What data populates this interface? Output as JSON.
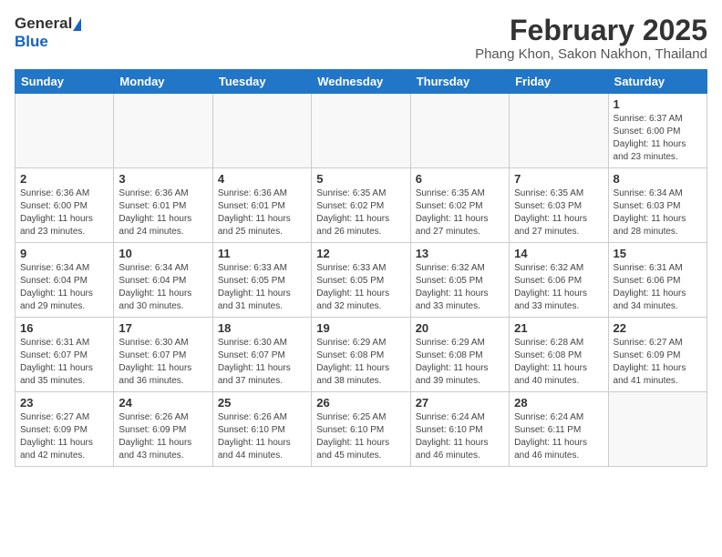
{
  "header": {
    "logo_general": "General",
    "logo_blue": "Blue",
    "title": "February 2025",
    "subtitle": "Phang Khon, Sakon Nakhon, Thailand"
  },
  "columns": [
    "Sunday",
    "Monday",
    "Tuesday",
    "Wednesday",
    "Thursday",
    "Friday",
    "Saturday"
  ],
  "weeks": [
    [
      {
        "day": "",
        "info": ""
      },
      {
        "day": "",
        "info": ""
      },
      {
        "day": "",
        "info": ""
      },
      {
        "day": "",
        "info": ""
      },
      {
        "day": "",
        "info": ""
      },
      {
        "day": "",
        "info": ""
      },
      {
        "day": "1",
        "info": "Sunrise: 6:37 AM\nSunset: 6:00 PM\nDaylight: 11 hours\nand 23 minutes."
      }
    ],
    [
      {
        "day": "2",
        "info": "Sunrise: 6:36 AM\nSunset: 6:00 PM\nDaylight: 11 hours\nand 23 minutes."
      },
      {
        "day": "3",
        "info": "Sunrise: 6:36 AM\nSunset: 6:01 PM\nDaylight: 11 hours\nand 24 minutes."
      },
      {
        "day": "4",
        "info": "Sunrise: 6:36 AM\nSunset: 6:01 PM\nDaylight: 11 hours\nand 25 minutes."
      },
      {
        "day": "5",
        "info": "Sunrise: 6:35 AM\nSunset: 6:02 PM\nDaylight: 11 hours\nand 26 minutes."
      },
      {
        "day": "6",
        "info": "Sunrise: 6:35 AM\nSunset: 6:02 PM\nDaylight: 11 hours\nand 27 minutes."
      },
      {
        "day": "7",
        "info": "Sunrise: 6:35 AM\nSunset: 6:03 PM\nDaylight: 11 hours\nand 27 minutes."
      },
      {
        "day": "8",
        "info": "Sunrise: 6:34 AM\nSunset: 6:03 PM\nDaylight: 11 hours\nand 28 minutes."
      }
    ],
    [
      {
        "day": "9",
        "info": "Sunrise: 6:34 AM\nSunset: 6:04 PM\nDaylight: 11 hours\nand 29 minutes."
      },
      {
        "day": "10",
        "info": "Sunrise: 6:34 AM\nSunset: 6:04 PM\nDaylight: 11 hours\nand 30 minutes."
      },
      {
        "day": "11",
        "info": "Sunrise: 6:33 AM\nSunset: 6:05 PM\nDaylight: 11 hours\nand 31 minutes."
      },
      {
        "day": "12",
        "info": "Sunrise: 6:33 AM\nSunset: 6:05 PM\nDaylight: 11 hours\nand 32 minutes."
      },
      {
        "day": "13",
        "info": "Sunrise: 6:32 AM\nSunset: 6:05 PM\nDaylight: 11 hours\nand 33 minutes."
      },
      {
        "day": "14",
        "info": "Sunrise: 6:32 AM\nSunset: 6:06 PM\nDaylight: 11 hours\nand 33 minutes."
      },
      {
        "day": "15",
        "info": "Sunrise: 6:31 AM\nSunset: 6:06 PM\nDaylight: 11 hours\nand 34 minutes."
      }
    ],
    [
      {
        "day": "16",
        "info": "Sunrise: 6:31 AM\nSunset: 6:07 PM\nDaylight: 11 hours\nand 35 minutes."
      },
      {
        "day": "17",
        "info": "Sunrise: 6:30 AM\nSunset: 6:07 PM\nDaylight: 11 hours\nand 36 minutes."
      },
      {
        "day": "18",
        "info": "Sunrise: 6:30 AM\nSunset: 6:07 PM\nDaylight: 11 hours\nand 37 minutes."
      },
      {
        "day": "19",
        "info": "Sunrise: 6:29 AM\nSunset: 6:08 PM\nDaylight: 11 hours\nand 38 minutes."
      },
      {
        "day": "20",
        "info": "Sunrise: 6:29 AM\nSunset: 6:08 PM\nDaylight: 11 hours\nand 39 minutes."
      },
      {
        "day": "21",
        "info": "Sunrise: 6:28 AM\nSunset: 6:08 PM\nDaylight: 11 hours\nand 40 minutes."
      },
      {
        "day": "22",
        "info": "Sunrise: 6:27 AM\nSunset: 6:09 PM\nDaylight: 11 hours\nand 41 minutes."
      }
    ],
    [
      {
        "day": "23",
        "info": "Sunrise: 6:27 AM\nSunset: 6:09 PM\nDaylight: 11 hours\nand 42 minutes."
      },
      {
        "day": "24",
        "info": "Sunrise: 6:26 AM\nSunset: 6:09 PM\nDaylight: 11 hours\nand 43 minutes."
      },
      {
        "day": "25",
        "info": "Sunrise: 6:26 AM\nSunset: 6:10 PM\nDaylight: 11 hours\nand 44 minutes."
      },
      {
        "day": "26",
        "info": "Sunrise: 6:25 AM\nSunset: 6:10 PM\nDaylight: 11 hours\nand 45 minutes."
      },
      {
        "day": "27",
        "info": "Sunrise: 6:24 AM\nSunset: 6:10 PM\nDaylight: 11 hours\nand 46 minutes."
      },
      {
        "day": "28",
        "info": "Sunrise: 6:24 AM\nSunset: 6:11 PM\nDaylight: 11 hours\nand 46 minutes."
      },
      {
        "day": "",
        "info": ""
      }
    ]
  ]
}
